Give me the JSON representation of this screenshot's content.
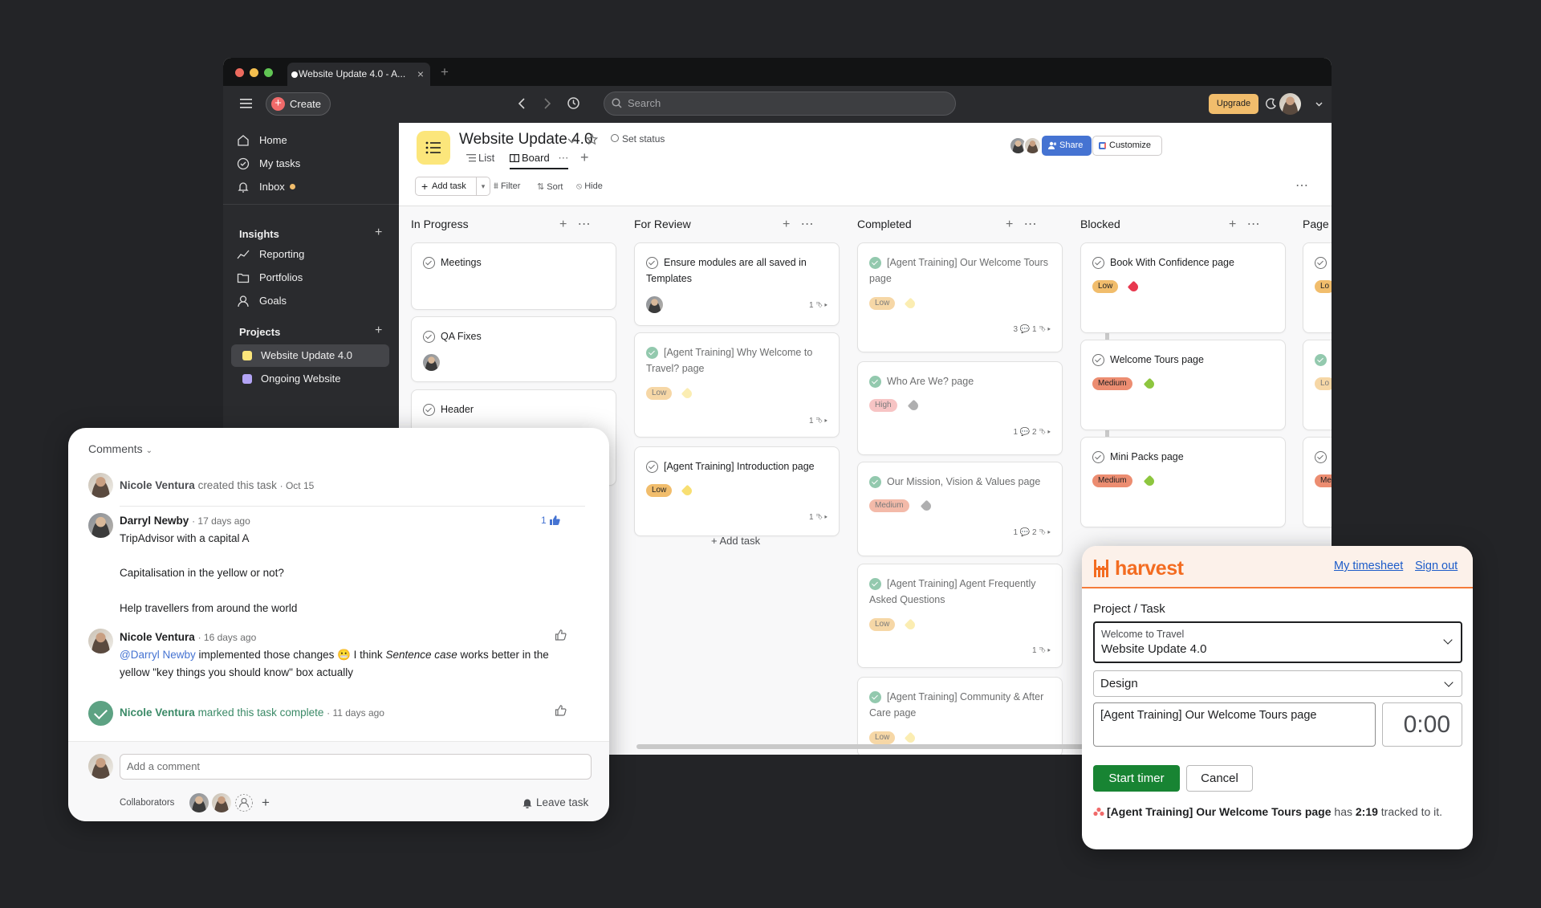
{
  "browser": {
    "tab_title": "Website Update 4.0 - A...",
    "close_glyph": "×",
    "new_tab_glyph": "+",
    "traffic_lights": [
      "#ec6a5e",
      "#f4bf4f",
      "#61c554"
    ]
  },
  "topbar": {
    "create_label": "Create",
    "search_placeholder": "Search",
    "upgrade_label": "Upgrade"
  },
  "sidebar": {
    "nav": [
      {
        "label": "Home",
        "icon": "home-icon"
      },
      {
        "label": "My tasks",
        "icon": "check-circle-icon"
      },
      {
        "label": "Inbox",
        "icon": "bell-icon"
      }
    ],
    "insights_heading": "Insights",
    "insights": [
      {
        "label": "Reporting",
        "icon": "line-chart-icon"
      },
      {
        "label": "Portfolios",
        "icon": "folder-icon"
      },
      {
        "label": "Goals",
        "icon": "person-icon"
      }
    ],
    "projects_heading": "Projects",
    "projects": [
      {
        "label": "Website Update 4.0",
        "color": "#fce67b"
      },
      {
        "label": "Ongoing Website",
        "color": "#b3a4f5"
      }
    ]
  },
  "project": {
    "title": "Website Update 4.0",
    "set_status": "Set status",
    "tabs": [
      "List",
      "Board"
    ],
    "share_label": "Share",
    "customize_label": "Customize",
    "add_task_label": "Add task",
    "filter_label": "Filter",
    "sort_label": "Sort",
    "hide_label": "Hide"
  },
  "board": {
    "columns": [
      {
        "title": "In Progress"
      },
      {
        "title": "For Review",
        "add_task_label": "Add task"
      },
      {
        "title": "Completed"
      },
      {
        "title": "Blocked"
      },
      {
        "title": "Page"
      }
    ],
    "in_progress": [
      {
        "title": "Meetings"
      },
      {
        "title": "QA Fixes"
      },
      {
        "title": "Header"
      }
    ],
    "for_review": [
      {
        "title": "Ensure modules are all saved in Templates",
        "meta": "1 ⮷ ▸"
      },
      {
        "title": "[Agent Training] Why Welcome to Travel? page",
        "priority": "Low",
        "meta": "1 ⮷ ▸"
      },
      {
        "title": "[Agent Training] Introduction page",
        "priority": "Low",
        "meta": "1 ⮷ ▸"
      }
    ],
    "completed": [
      {
        "title": "[Agent Training] Our Welcome Tours page",
        "priority": "Low",
        "meta": "3 💬  1 ⮷ ▸"
      },
      {
        "title": "Who Are We? page",
        "priority": "High",
        "meta": "1 💬  2 ⮷ ▸"
      },
      {
        "title": "Our Mission, Vision & Values page",
        "priority": "Medium",
        "meta": "1 💬  2 ⮷ ▸"
      },
      {
        "title": "[Agent Training] Agent Frequently Asked Questions",
        "priority": "Low",
        "meta": "1 ⮷ ▸"
      },
      {
        "title": "[Agent Training] Community & After Care page",
        "priority": "Low"
      }
    ],
    "blocked": [
      {
        "title": "Book With Confidence page",
        "priority": "Low"
      },
      {
        "title": "Welcome Tours page",
        "priority": "Medium"
      },
      {
        "title": "Mini Packs page",
        "priority": "Medium"
      }
    ],
    "page_col_pills": [
      "Lo",
      "Lo",
      "Me"
    ]
  },
  "comments": {
    "heading": "Comments",
    "created": {
      "name": "Nicole Ventura",
      "action": "created this task",
      "time": "· Oct 15"
    },
    "darryl": {
      "name": "Darryl Newby",
      "time": "· 17 days ago",
      "likes": "1",
      "line1": "TripAdvisor with a capital A",
      "line2": "Capitalisation in the yellow or not?",
      "line3": "Help travellers from around the world"
    },
    "nicole": {
      "name": "Nicole Ventura",
      "time": "· 16 days ago",
      "mention": "@Darryl Newby",
      "text_a": "implemented those changes 😬 I think",
      "emph": "Sentence case",
      "text_b": "works better in the",
      "line2": "yellow \"key things you should know\" box actually"
    },
    "complete": {
      "name": "Nicole Ventura",
      "action": "marked this task complete",
      "time": "· 11 days ago"
    },
    "input_placeholder": "Add a comment",
    "collaborators_label": "Collaborators",
    "leave_label": "Leave task"
  },
  "harvest": {
    "brand": "harvest",
    "timesheet_link": "My timesheet",
    "signout_link": "Sign out",
    "project_task_label": "Project / Task",
    "client": "Welcome to Travel",
    "project": "Website Update 4.0",
    "task": "Design",
    "notes": "[Agent Training] Our Welcome Tours page",
    "time": "0:00",
    "start_label": "Start timer",
    "cancel_label": "Cancel",
    "footer_task": "[Agent Training] Our Welcome Tours page",
    "footer_has": "has",
    "footer_time": "2:19",
    "footer_tail": "tracked to it."
  }
}
